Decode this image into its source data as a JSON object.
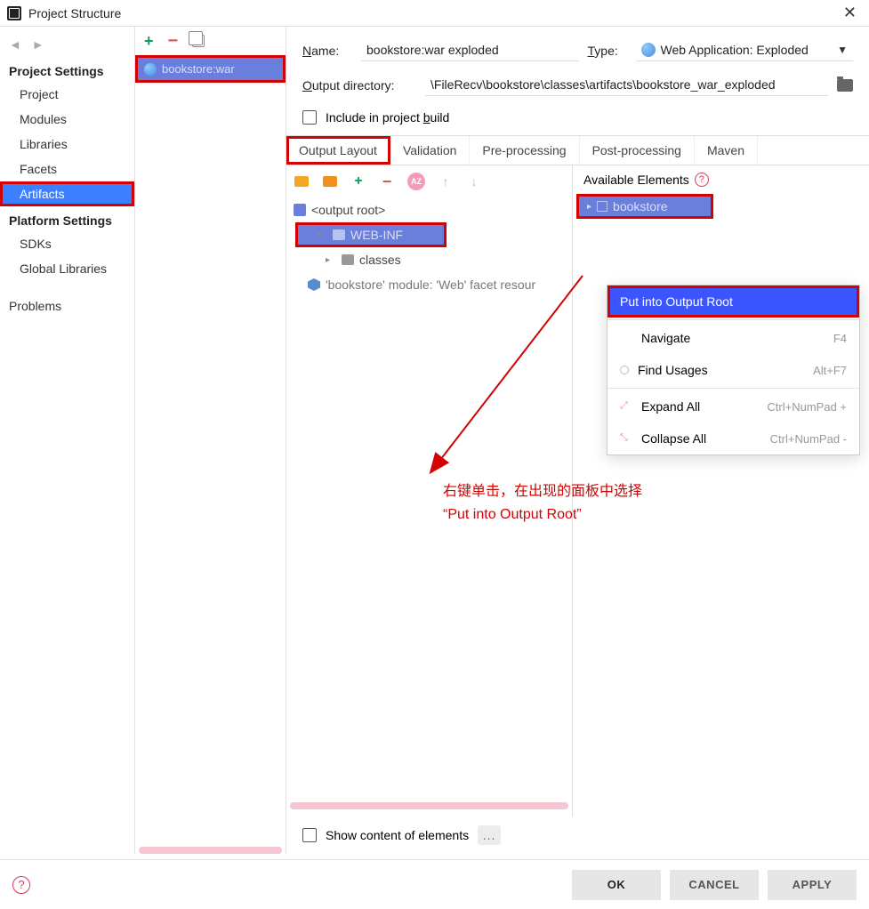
{
  "window": {
    "title": "Project Structure"
  },
  "sidebar": {
    "section1": "Project Settings",
    "items1": [
      "Project",
      "Modules",
      "Libraries",
      "Facets",
      "Artifacts"
    ],
    "section2": "Platform Settings",
    "items2": [
      "SDKs",
      "Global Libraries"
    ],
    "problems": "Problems"
  },
  "artifactList": {
    "item": "bookstore:war"
  },
  "form": {
    "nameLabel": "Name:",
    "nameValue": "bookstore:war exploded",
    "typeLabel": "Type:",
    "typeValue": "Web Application: Exploded",
    "outdirLabel": "Output directory:",
    "outdirValue": "\\FileRecv\\bookstore\\classes\\artifacts\\bookstore_war_exploded",
    "includeLabel": "Include in project build"
  },
  "tabs": [
    "Output Layout",
    "Validation",
    "Pre-processing",
    "Post-processing",
    "Maven"
  ],
  "layoutTree": {
    "root": "<output root>",
    "webinf": "WEB-INF",
    "classes": "classes",
    "facet": "'bookstore' module: 'Web' facet resour"
  },
  "available": {
    "header": "Available Elements",
    "item": "bookstore"
  },
  "contextMenu": {
    "putRoot": "Put into Output Root",
    "navigate": {
      "label": "Navigate",
      "shortcut": "F4"
    },
    "findUsages": {
      "label": "Find Usages",
      "shortcut": "Alt+F7"
    },
    "expandAll": {
      "label": "Expand All",
      "shortcut": "Ctrl+NumPad +"
    },
    "collapseAll": {
      "label": "Collapse All",
      "shortcut": "Ctrl+NumPad -"
    }
  },
  "annotation": {
    "line1": "右键单击，在出现的面板中选择",
    "line2": "“Put into Output Root”"
  },
  "bottom": {
    "showContent": "Show content of elements"
  },
  "footer": {
    "ok": "OK",
    "cancel": "CANCEL",
    "apply": "APPLY"
  }
}
